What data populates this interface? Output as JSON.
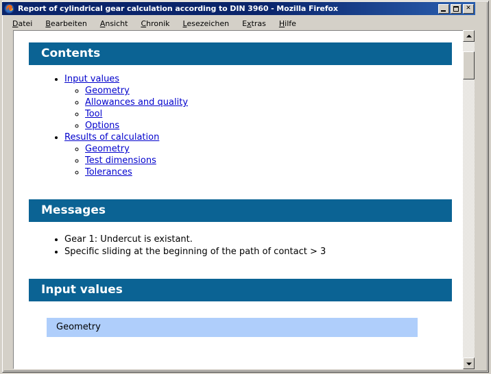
{
  "window": {
    "title": "Report of cylindrical gear calculation according to DIN 3960 - Mozilla Firefox",
    "app_icon": "firefox-icon",
    "controls": {
      "minimize_label": "_",
      "maximize_label": "□",
      "close_label": "✕"
    }
  },
  "menubar": {
    "items": [
      {
        "label": "Datei",
        "accel": "D"
      },
      {
        "label": "Bearbeiten",
        "accel": "B"
      },
      {
        "label": "Ansicht",
        "accel": "A"
      },
      {
        "label": "Chronik",
        "accel": "C"
      },
      {
        "label": "Lesezeichen",
        "accel": "L"
      },
      {
        "label": "Extras",
        "accel": "x"
      },
      {
        "label": "Hilfe",
        "accel": "H"
      }
    ]
  },
  "report": {
    "contents": {
      "heading": "Contents",
      "groups": [
        {
          "label": "Input values",
          "children": [
            "Geometry",
            "Allowances and quality",
            "Tool",
            "Options"
          ]
        },
        {
          "label": "Results of calculation",
          "children": [
            "Geometry",
            "Test dimensions",
            "Tolerances"
          ]
        }
      ]
    },
    "messages": {
      "heading": "Messages",
      "items": [
        "Gear 1: Undercut is existant.",
        "Specific sliding at the beginning of the path of contact > 3"
      ]
    },
    "input_values": {
      "heading": "Input values",
      "subsection": "Geometry"
    }
  },
  "scrollbar": {
    "up_arrow": "▲",
    "down_arrow": "▼"
  },
  "colors": {
    "header_bar": "#0b6394",
    "subsection_bar": "#afcefb",
    "link": "#0000cc",
    "titlebar": "#0a246a",
    "chrome": "#d4d0c8"
  }
}
